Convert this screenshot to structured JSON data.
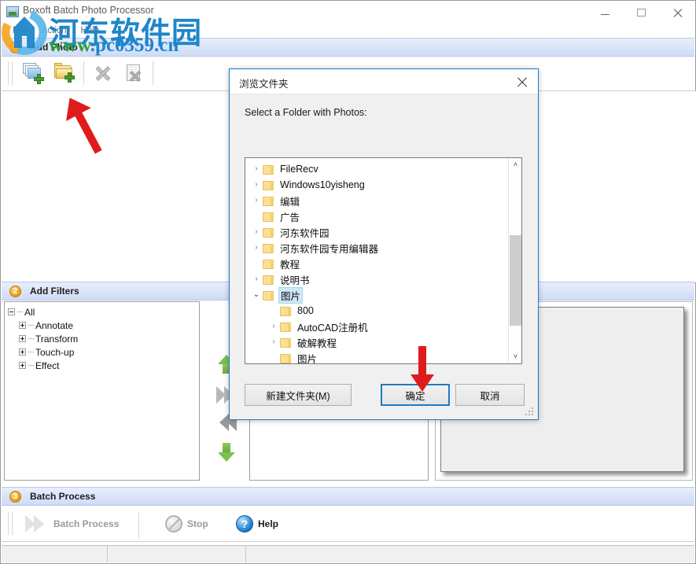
{
  "window": {
    "title": "Boxoft Batch Photo Processor",
    "icon": "app-icon",
    "minimize": "—",
    "maximize": "□",
    "close": "✕"
  },
  "menubar": {
    "items": [
      "File",
      "Action",
      "Help"
    ]
  },
  "sections": {
    "add_photo": {
      "number": "1",
      "title": "Add Photo"
    },
    "add_filters": {
      "number": "2",
      "title": "Add Filters"
    },
    "batch_process": {
      "number": "3",
      "title": "Batch Process"
    }
  },
  "photo_toolbar": {
    "buttons": [
      {
        "name": "add-photo-button",
        "icon": "add-photo-icon",
        "tooltip": "Add Photo"
      },
      {
        "name": "add-folder-button",
        "icon": "add-folder-icon",
        "tooltip": "Add Folder"
      },
      {
        "name": "remove-photo-button",
        "icon": "remove-x-icon",
        "tooltip": "Remove"
      },
      {
        "name": "clear-list-button",
        "icon": "clear-list-icon",
        "tooltip": "Clear All"
      }
    ]
  },
  "filters_tree": {
    "root": "All",
    "children": [
      "Annotate",
      "Transform",
      "Touch-up",
      "Effect"
    ]
  },
  "arrows": {
    "move_up": "move-up-arrow",
    "add_filter": "add-filter-arrow",
    "remove_filter": "remove-filter-arrow",
    "move_down": "move-down-arrow"
  },
  "batch_toolbar": {
    "batch_process_label": "Batch Process",
    "stop_label": "Stop",
    "help_label": "Help"
  },
  "dialog": {
    "title": "浏览文件夹",
    "prompt": "Select a Folder with Photos:",
    "close": "✕",
    "tree": [
      {
        "label": "FileRecv",
        "indent": 0,
        "expandable": true,
        "expanded": false,
        "selected": false
      },
      {
        "label": "Windows10yisheng",
        "indent": 0,
        "expandable": true,
        "expanded": false,
        "selected": false
      },
      {
        "label": "编辑",
        "indent": 0,
        "expandable": true,
        "expanded": false,
        "selected": false
      },
      {
        "label": "广告",
        "indent": 0,
        "expandable": false,
        "expanded": false,
        "selected": false
      },
      {
        "label": "河东软件园",
        "indent": 0,
        "expandable": true,
        "expanded": false,
        "selected": false
      },
      {
        "label": "河东软件园专用编辑器",
        "indent": 0,
        "expandable": true,
        "expanded": false,
        "selected": false
      },
      {
        "label": "教程",
        "indent": 0,
        "expandable": false,
        "expanded": false,
        "selected": false
      },
      {
        "label": "说明书",
        "indent": 0,
        "expandable": true,
        "expanded": false,
        "selected": false
      },
      {
        "label": "图片",
        "indent": 0,
        "expandable": true,
        "expanded": true,
        "selected": true
      },
      {
        "label": "800",
        "indent": 1,
        "expandable": false,
        "expanded": false,
        "selected": false
      },
      {
        "label": "AutoCAD注册机",
        "indent": 1,
        "expandable": true,
        "expanded": false,
        "selected": false
      },
      {
        "label": "破解教程",
        "indent": 1,
        "expandable": true,
        "expanded": false,
        "selected": false
      },
      {
        "label": "图片",
        "indent": 1,
        "expandable": false,
        "expanded": false,
        "selected": false
      }
    ],
    "scroll_up": "˄",
    "scroll_down": "˅",
    "buttons": {
      "new_folder": "新建文件夹(M)",
      "ok": "确定",
      "cancel": "取消"
    }
  },
  "watermark": {
    "cn_text": "河东软件园",
    "url_www": "www",
    "url_rest": ".pc0359.cn",
    "color": "#1f86c9"
  },
  "annotations": {
    "arrow_to_add_folder": "red-pointer-arrow-toolbar",
    "arrow_to_ok_button": "red-pointer-arrow-ok"
  },
  "colors": {
    "accent": "#1f7bc4",
    "section_header": "#dbe5fa",
    "badge": "#f5a623",
    "selection": "#cde8f7",
    "annotation_red": "#e01b1b"
  }
}
